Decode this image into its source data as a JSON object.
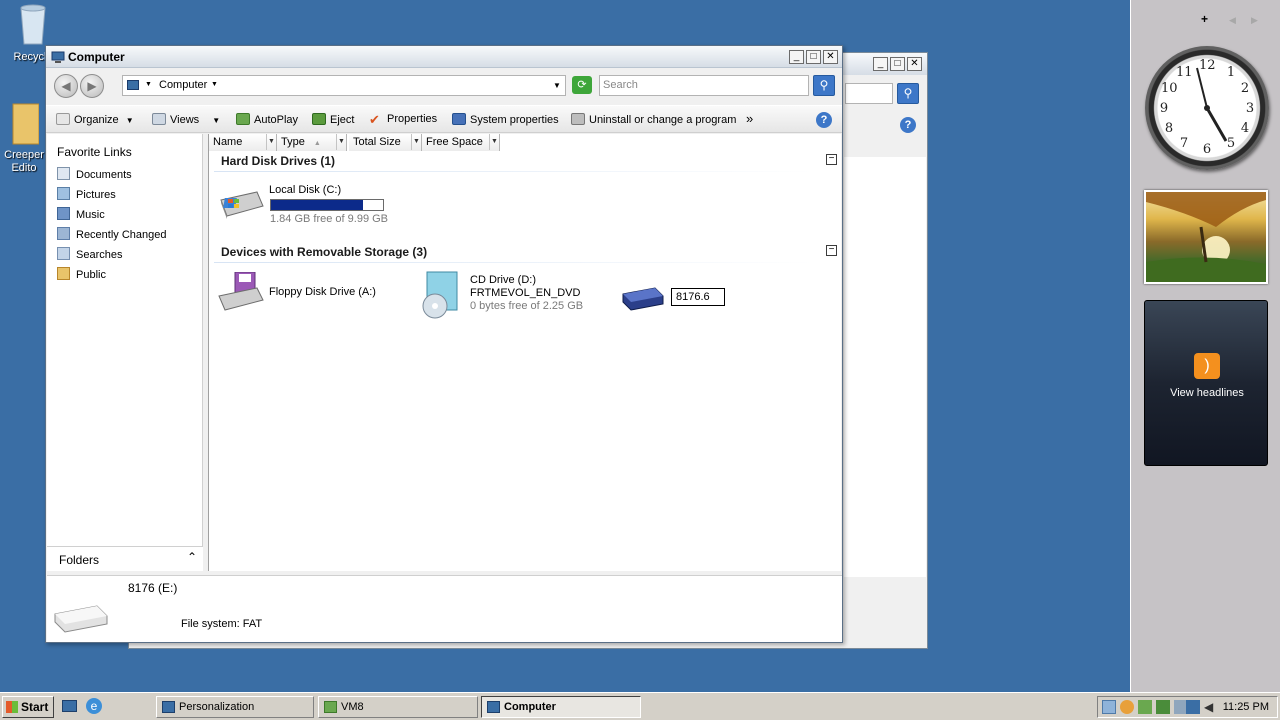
{
  "desktop": {
    "icons": [
      {
        "label": "Recycle"
      },
      {
        "label": "Creeper Edito"
      }
    ]
  },
  "sidebar": {
    "add_button": "+",
    "prev_button": "◀",
    "next_button": "▶",
    "clock_numbers": [
      "12",
      "1",
      "2",
      "3",
      "4",
      "5",
      "6",
      "7",
      "8",
      "9",
      "10",
      "11"
    ],
    "feed_text": "View headlines"
  },
  "window": {
    "title": "Computer",
    "address": "Computer",
    "search_placeholder": "Search",
    "toolbar": {
      "organize": "Organize",
      "views": "Views",
      "autoplay": "AutoPlay",
      "eject": "Eject",
      "properties": "Properties",
      "system_properties": "System properties",
      "uninstall": "Uninstall or change a program",
      "more": "»"
    },
    "nav": {
      "favorite_links_title": "Favorite Links",
      "items": [
        "Documents",
        "Pictures",
        "Music",
        "Recently Changed",
        "Searches",
        "Public"
      ],
      "folders": "Folders"
    },
    "columns": [
      "Name",
      "Type",
      "Total Size",
      "Free Space"
    ],
    "groups": {
      "hard_disk": "Hard Disk Drives (1)",
      "removable": "Devices with Removable Storage (3)"
    },
    "drives": {
      "local_disk": {
        "name": "Local Disk (C:)",
        "sub": "1.84 GB free of 9.99 GB",
        "used_fraction": 0.82
      },
      "floppy": {
        "name": "Floppy Disk Drive (A:)"
      },
      "cd": {
        "name": "CD Drive (D:)",
        "label": "FRTMEVOL_EN_DVD",
        "sub": "0 bytes free of 2.25 GB"
      },
      "rename_value": "8176.6"
    },
    "details": {
      "name": "8176 (E:)",
      "filesystem": "File system: FAT"
    }
  },
  "taskbar": {
    "start": "Start",
    "tasks": [
      "Personalization",
      "VM8",
      "Computer"
    ],
    "time": "11:25 PM"
  },
  "colors": {
    "desktop": "#3a6ea5",
    "usage_fill": "#0c2a8a"
  }
}
